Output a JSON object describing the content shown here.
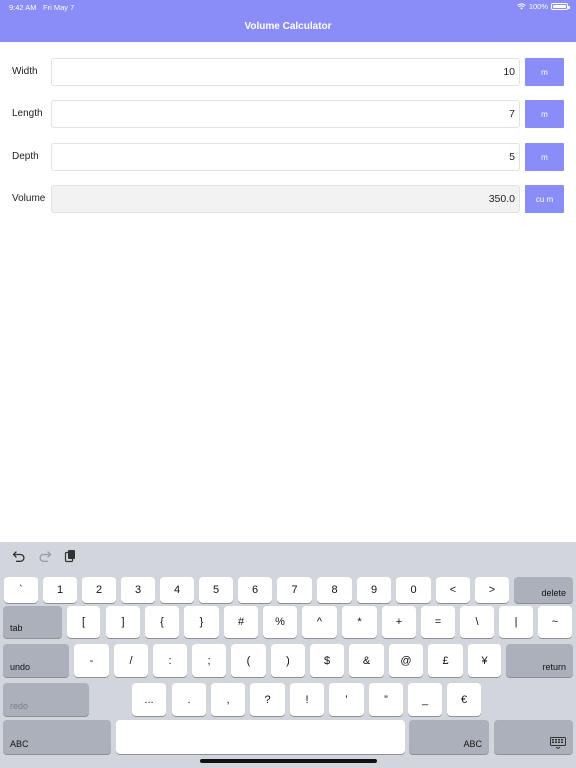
{
  "status_bar": {
    "time": "9:42 AM",
    "date": "Fri May 7",
    "battery": "100%"
  },
  "header": {
    "title": "Volume Calculator"
  },
  "form": {
    "rows": [
      {
        "label": "Width",
        "value": "10",
        "unit": "m"
      },
      {
        "label": "Length",
        "value": "7",
        "unit": "m"
      },
      {
        "label": "Depth",
        "value": "5",
        "unit": "m"
      },
      {
        "label": "Volume",
        "value": "350.0",
        "unit": "cu m"
      }
    ]
  },
  "keyboard": {
    "row1": [
      "`",
      "1",
      "2",
      "3",
      "4",
      "5",
      "6",
      "7",
      "8",
      "9",
      "0",
      "<",
      ">"
    ],
    "delete": "delete",
    "tab": "tab",
    "row2": [
      "[",
      "]",
      "{",
      "}",
      "#",
      "%",
      "^",
      "*",
      "+",
      "=",
      "\\",
      "|",
      "~"
    ],
    "undo": "undo",
    "row3": [
      "-",
      "/",
      ":",
      ";",
      "(",
      ")",
      "$",
      "&",
      "@",
      "£",
      "¥"
    ],
    "return": "return",
    "redo": "redo",
    "row4": [
      "...",
      ".",
      ",",
      "?",
      "!",
      "’",
      "”",
      "_",
      "€"
    ],
    "abc_left": "ABC",
    "abc_right": "ABC"
  }
}
